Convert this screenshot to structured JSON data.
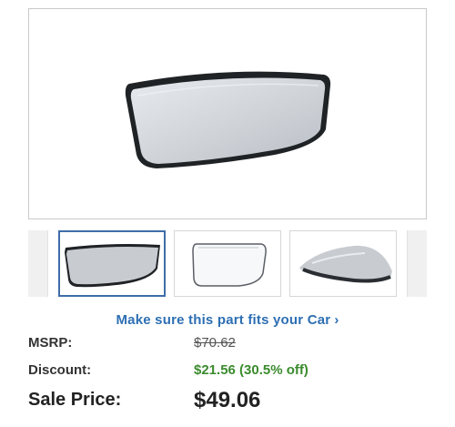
{
  "product": {
    "main_image": "mirror-glass-main-photo",
    "thumbnails": [
      {
        "image": "mirror-glass-front-photo",
        "selected": true
      },
      {
        "image": "mirror-glass-outline-photo",
        "selected": false
      },
      {
        "image": "mirror-glass-angle-photo",
        "selected": false
      }
    ]
  },
  "fitment": {
    "link_label": "Make sure this part fits your Car",
    "chevron": "›",
    "icon": "chevron-right-icon"
  },
  "pricing": {
    "msrp_label": "MSRP:",
    "msrp_value": "$70.62",
    "discount_label": "Discount:",
    "discount_value": "$21.56 (30.5% off)",
    "sale_label": "Sale Price:",
    "sale_value": "$49.06"
  },
  "colors": {
    "link": "#2d6fb3",
    "discount": "#3b8b2e",
    "active_thumb_border": "#3e6da8"
  }
}
